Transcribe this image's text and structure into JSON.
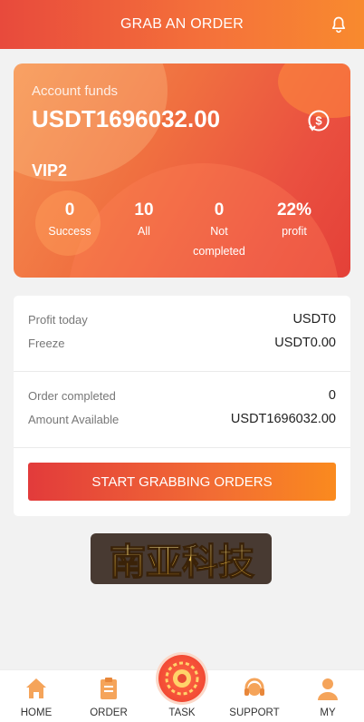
{
  "header": {
    "title": "GRAB AN ORDER",
    "bell_icon": "bell-icon"
  },
  "account": {
    "funds_label": "Account funds",
    "funds_value": "USDT1696032.00",
    "vip": "VIP2",
    "coin_icon": "dollar-exchange-icon",
    "stats": [
      {
        "value": "0",
        "label": "Success"
      },
      {
        "value": "10",
        "label": "All"
      },
      {
        "value": "0",
        "label": "Not completed"
      },
      {
        "value": "22%",
        "label": "profit"
      }
    ]
  },
  "summary": {
    "profit_today_label": "Profit today",
    "profit_today_value": "USDT0",
    "freeze_label": "Freeze",
    "freeze_value": "USDT0.00",
    "order_completed_label": "Order completed",
    "order_completed_value": "0",
    "amount_available_label": "Amount Available",
    "amount_available_value": "USDT1696032.00",
    "grab_button": "START GRABBING ORDERS"
  },
  "logo": {
    "text": "南亚科技"
  },
  "tabbar": [
    {
      "label": "HOME",
      "icon": "home-icon"
    },
    {
      "label": "ORDER",
      "icon": "clipboard-icon"
    },
    {
      "label": "TASK",
      "icon": "task-wheel-icon"
    },
    {
      "label": "SUPPORT",
      "icon": "headset-icon"
    },
    {
      "label": "MY",
      "icon": "user-icon"
    }
  ],
  "colors": {
    "accent": "#f26c34",
    "accent_red": "#e23b3b",
    "icon_orange": "#f5a45a"
  }
}
